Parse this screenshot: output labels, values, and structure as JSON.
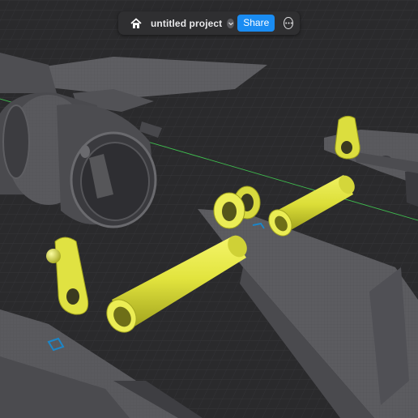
{
  "toolbar": {
    "home_icon": "home-icon",
    "project_name": "untitled project",
    "dropdown_icon": "chevron-down-icon",
    "share_label": "Share",
    "more_icon": "more-options-icon"
  },
  "scene": {
    "accent_color": "#e6e84a",
    "viewport_background": "#2a2a2c",
    "grid_color": "#3c3c40",
    "axis_color": "#3fbf4f",
    "gizmo_color": "#1b86c8"
  }
}
